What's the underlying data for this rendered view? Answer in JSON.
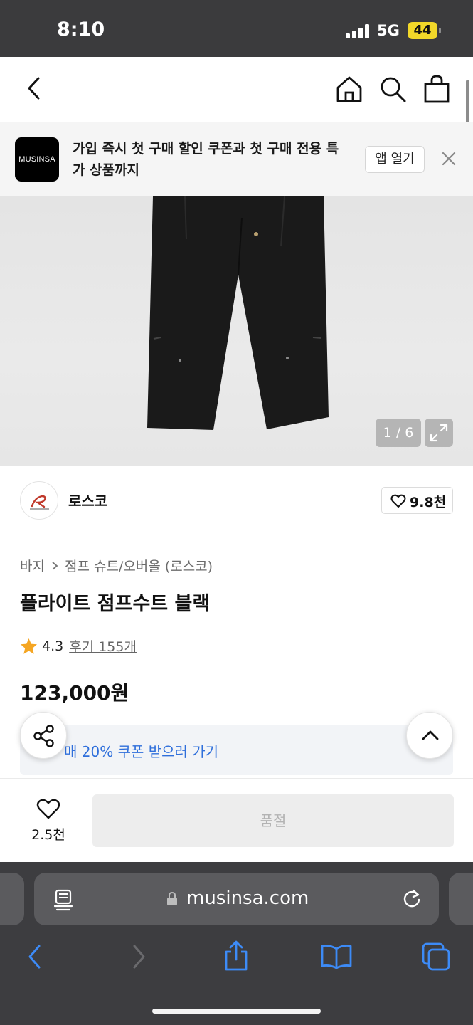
{
  "status_bar": {
    "time": "8:10",
    "network": "5G",
    "battery": "44"
  },
  "app_banner": {
    "logo_text": "MUSINSA",
    "message": "가입 즉시 첫 구매 할인 쿠폰과 첫 구매 전용 특가 상품까지",
    "open_app_label": "앱 열기"
  },
  "gallery": {
    "counter": "1 / 6"
  },
  "brand": {
    "name": "로스코",
    "like_count": "9.8천"
  },
  "breadcrumb": {
    "category": "바지",
    "subcategory": "점프 슈트/오버올 (로스코)"
  },
  "product": {
    "title": "플라이트 점프수트 블랙",
    "rating": "4.3",
    "reviews": "후기 155개",
    "price": "123,000원"
  },
  "coupon": {
    "text": "매 20% 쿠폰 받으러 가기"
  },
  "action_bar": {
    "wish_count": "2.5천",
    "buy_label": "품절"
  },
  "browser": {
    "url": "musinsa.com"
  },
  "colors": {
    "accent_blue": "#2f6fdb",
    "star": "#f5a623",
    "safari_blue": "#3d8bf7"
  }
}
